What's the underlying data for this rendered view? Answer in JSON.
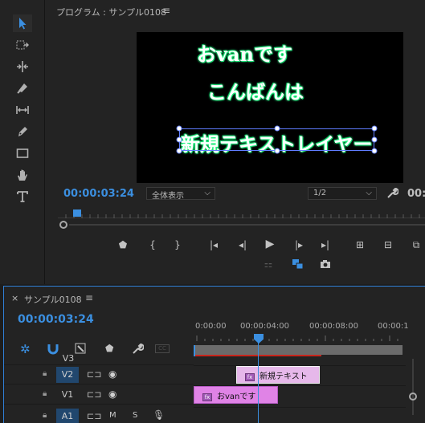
{
  "program_monitor": {
    "title": "プログラム : サンプル0108",
    "menu_glyph": "≡",
    "video_text": {
      "line1": "おvanです",
      "line2": "こんばんは",
      "line3": "新規テキストレイヤー"
    },
    "timecode": "00:00:03:24",
    "zoom_value": "全体表示",
    "resolution_value": "1/2",
    "duration_partial": "00:"
  },
  "timeline": {
    "close_glyph": "×",
    "title": "サンプル0108",
    "menu_glyph": "≡",
    "timecode": "00:00:03:24",
    "ruler": [
      "0:00:00",
      "00:00:04:00",
      "00:00:08:00",
      "00:00:1"
    ],
    "tracks": [
      {
        "label": "V3"
      },
      {
        "label": "V2"
      },
      {
        "label": "V1"
      },
      {
        "label": "A1",
        "m": "M",
        "s": "S"
      }
    ],
    "clips": [
      {
        "label": "新規テキスト",
        "fx": "fx"
      },
      {
        "label": "おvanです",
        "fx": "fx"
      }
    ]
  },
  "colors": {
    "accent_blue": "#3b8fe0",
    "clip_pink": "#e083e6",
    "text_glow": "#2cff8a",
    "selection": "#5f7cff"
  }
}
